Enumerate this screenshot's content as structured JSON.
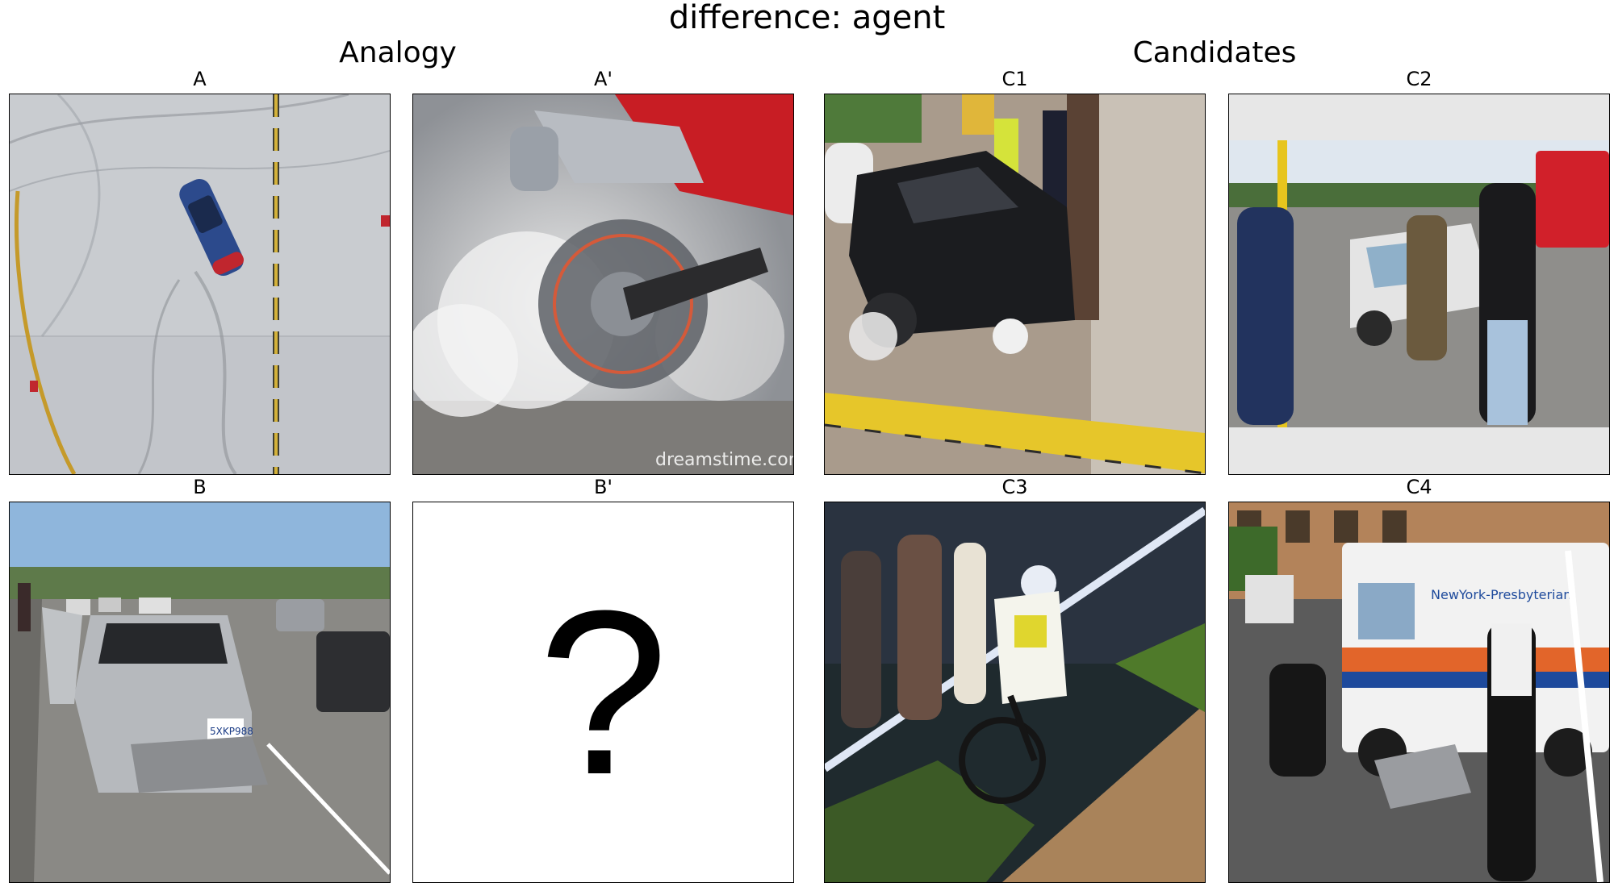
{
  "suptitle": "difference: agent",
  "groups": {
    "analogy": "Analogy",
    "candidates": "Candidates"
  },
  "panels": {
    "A": {
      "label": "A"
    },
    "A_prime": {
      "label": "A'",
      "watermark": "dreamstime.com"
    },
    "B": {
      "label": "B",
      "plate": "5XKP988"
    },
    "B_prime": {
      "label": "B'",
      "symbol": "?"
    },
    "C1": {
      "label": "C1"
    },
    "C2": {
      "label": "C2"
    },
    "C3": {
      "label": "C3"
    },
    "C4": {
      "label": "C4",
      "ambulance_text": "NewYork-Presbyterian"
    }
  }
}
